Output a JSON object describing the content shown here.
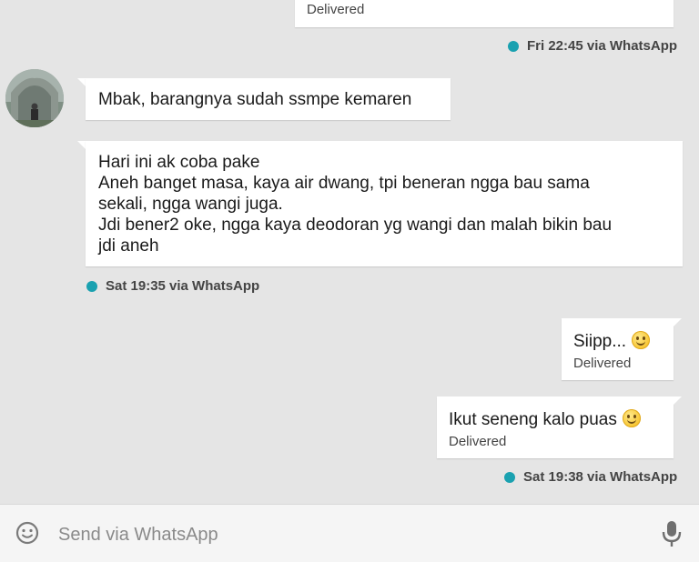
{
  "messages": [
    {
      "type": "sent",
      "status": "Delivered"
    },
    {
      "type": "status",
      "text": "Fri 22:45 via WhatsApp"
    },
    {
      "type": "received",
      "text": "Mbak, barangnya sudah ssmpe kemaren"
    },
    {
      "type": "received",
      "text": "Hari ini ak coba pake\nAneh banget masa, kaya air dwang, tpi beneran ngga bau sama\nsekali, ngga wangi juga.\nJdi bener2 oke, ngga kaya deodoran yg wangi dan malah bikin bau\njdi aneh"
    },
    {
      "type": "status",
      "text": "Sat 19:35 via WhatsApp"
    },
    {
      "type": "sent",
      "text": "Siipp...",
      "emoji": "smiling-face-emoji",
      "status": "Delivered"
    },
    {
      "type": "sent",
      "text": "Ikut seneng kalo puas",
      "emoji": "smiling-face-emoji",
      "status": "Delivered"
    },
    {
      "type": "status",
      "text": "Sat 19:38 via WhatsApp"
    }
  ],
  "input": {
    "placeholder": "Send via WhatsApp",
    "emoji_icon": "smiley-icon",
    "mic_icon": "microphone-icon"
  },
  "colors": {
    "background": "#e5e5e5",
    "bubble": "#ffffff",
    "status_dot": "#1aa1b0"
  }
}
